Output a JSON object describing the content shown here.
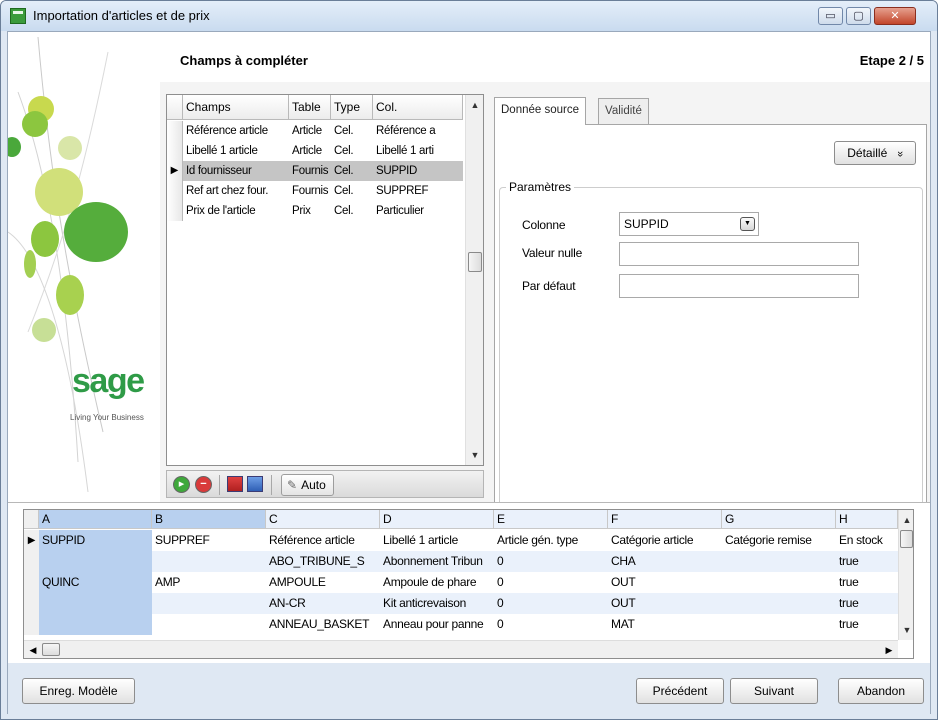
{
  "window": {
    "title": "Importation d'articles et de prix",
    "controls": {
      "minimize": "▭",
      "maximize": "▢",
      "close": "✕"
    }
  },
  "brand": {
    "logo_text": "sage",
    "tagline": "Living Your Business"
  },
  "header": {
    "title": "Champs à compléter",
    "step": "Etape  2 / 5"
  },
  "fields_grid": {
    "columns": [
      "Champs",
      "Table",
      "Type",
      "Col."
    ],
    "rows": [
      {
        "champs": "Référence article",
        "table": "Article",
        "type": "Cel.",
        "col": "Référence a"
      },
      {
        "champs": "Libellé 1 article",
        "table": "Article",
        "type": "Cel.",
        "col": "Libellé 1 arti"
      },
      {
        "champs": "Id fournisseur",
        "table": "Fournis",
        "type": "Cel.",
        "col": "SUPPID",
        "selected": true
      },
      {
        "champs": "Ref art chez four.",
        "table": "Fournis",
        "type": "Cel.",
        "col": "SUPPREF"
      },
      {
        "champs": "Prix de l'article",
        "table": "Prix",
        "type": "Cel.",
        "col": "Particulier"
      }
    ],
    "selected_marker": "▶"
  },
  "toolbar": {
    "add_icon": "add-icon",
    "remove_icon": "remove-icon",
    "auto_label": "Auto"
  },
  "tabs": [
    {
      "label": "Donnée source",
      "active": true
    },
    {
      "label": "Validité",
      "active": false
    }
  ],
  "detail_button": {
    "label": "Détaillé",
    "chevron": "»"
  },
  "params": {
    "legend": "Paramètres",
    "column_label": "Colonne",
    "column_value": "SUPPID",
    "null_label": "Valeur nulle",
    "null_value": "",
    "default_label": "Par défaut",
    "default_value": ""
  },
  "data_grid": {
    "columns": [
      "A",
      "B",
      "C",
      "D",
      "E",
      "F",
      "G",
      "H"
    ],
    "rows": [
      [
        "SUPPID",
        "SUPPREF",
        "Référence article",
        "Libellé 1 article",
        "Article gén. type",
        "Catégorie article",
        "Catégorie remise",
        "En stock"
      ],
      [
        "",
        "",
        "ABO_TRIBUNE_S",
        "Abonnement Tribun",
        "0",
        "CHA",
        "",
        "true"
      ],
      [
        "QUINC",
        "AMP",
        "AMPOULE",
        "Ampoule de phare",
        "0",
        "OUT",
        "",
        "true"
      ],
      [
        "",
        "",
        "AN-CR",
        "Kit anticrevaison",
        "0",
        "OUT",
        "",
        "true"
      ],
      [
        "",
        "",
        "ANNEAU_BASKET",
        "Anneau pour panne",
        "0",
        "MAT",
        "",
        "true"
      ]
    ],
    "row_marker": "▶"
  },
  "footer": {
    "save_template": "Enreg. Modèle",
    "previous": "Précédent",
    "next": "Suivant",
    "cancel": "Abandon"
  },
  "colors": {
    "frame": "#dfe8f3",
    "selection_gray": "#c5c5c5",
    "column_highlight": "#b8d0ef",
    "leaf_green": "#8dc63f",
    "sage_green": "#2f9b47"
  }
}
